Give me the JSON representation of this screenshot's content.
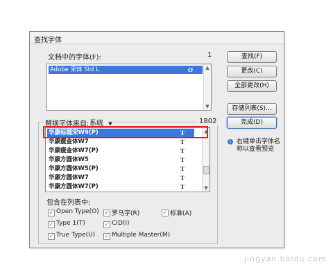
{
  "dialog": {
    "title": "查找字体"
  },
  "doc_fonts": {
    "label": "文档中的字体(F):",
    "count": "1",
    "items": [
      {
        "name": "Adobe 宋体 Std L",
        "icon": "O"
      }
    ]
  },
  "buttons": {
    "find": "查找(F)",
    "change": "更改(C)",
    "change_all": "全部更改(H)",
    "save_list": "存储列表(S)...",
    "done": "完成(D)"
  },
  "replace": {
    "label": "替换字体来自:",
    "source": "系统",
    "count": "1802",
    "items": [
      {
        "name": "华康标题宋W9(P)",
        "icon": "T",
        "selected": true
      },
      {
        "name": "华康瘦金体W7",
        "icon": "T",
        "selected": false
      },
      {
        "name": "华康瘦金体W7(P)",
        "icon": "T",
        "selected": false
      },
      {
        "name": "华康方圆体W5",
        "icon": "T",
        "selected": false
      },
      {
        "name": "华康方圆体W5(P)",
        "icon": "T",
        "selected": false
      },
      {
        "name": "华康方圆体W7",
        "icon": "T",
        "selected": false
      },
      {
        "name": "华康方圆体W7(P)",
        "icon": "T",
        "selected": false
      }
    ]
  },
  "include": {
    "label": "包含在列表中:",
    "options": [
      {
        "label": "Open Type(O)",
        "checked": true
      },
      {
        "label": "罗马字(R)",
        "checked": true
      },
      {
        "label": "标准(A)",
        "checked": true
      },
      {
        "label": "Type 1(T)",
        "checked": true
      },
      {
        "label": "CID(I)",
        "checked": true
      },
      {
        "label": "True Type(U)",
        "checked": true
      },
      {
        "label": "Multiple Master(M)",
        "checked": true
      }
    ]
  },
  "tip": {
    "text_line1": "右键单击字体名",
    "text_line2": "称以查看预览"
  },
  "watermark": "jingyan.baidu.com"
}
